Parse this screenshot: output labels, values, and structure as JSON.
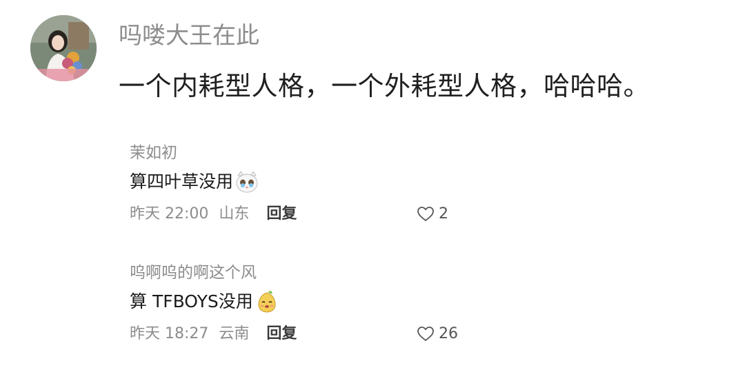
{
  "post": {
    "author": "吗喽大王在此",
    "text": "一个内耗型人格，一个外耗型人格，哈哈哈。"
  },
  "replies": [
    {
      "author": "茉如初",
      "text": "算四叶草没用",
      "emoji": "crying-cat-emoji",
      "time": "昨天 22:00",
      "location": "山东",
      "reply_label": "回复",
      "likes": "2"
    },
    {
      "author": "呜啊呜的啊这个风",
      "text": "算 TFBOYS没用",
      "emoji": "shy-pear-emoji",
      "time": "昨天 18:27",
      "location": "云南",
      "reply_label": "回复",
      "likes": "26"
    }
  ],
  "icons": {
    "like": "heart-outline-icon"
  }
}
